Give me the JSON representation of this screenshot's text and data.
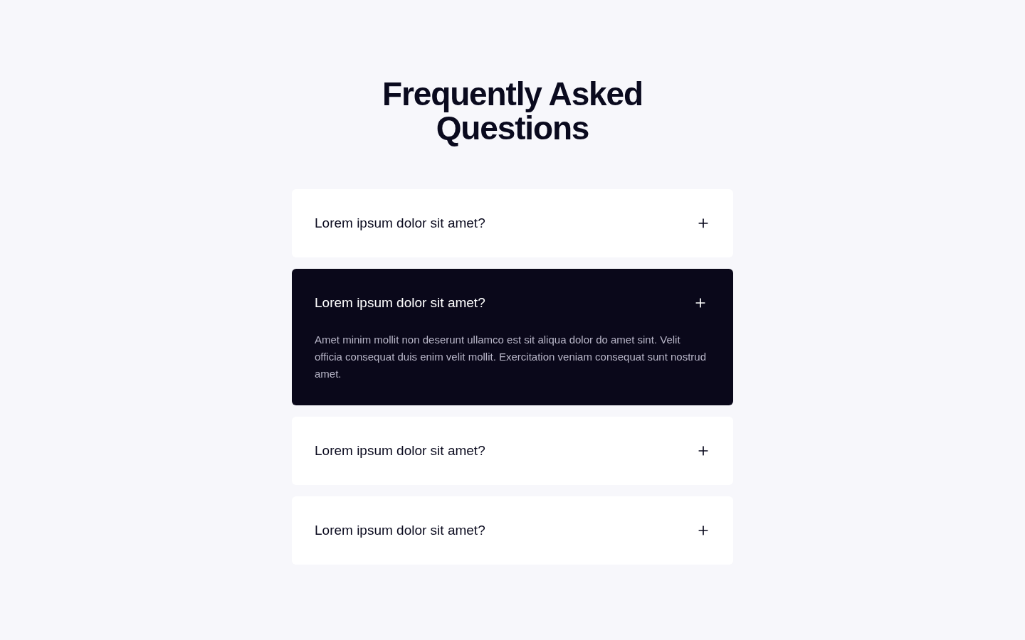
{
  "title": "Frequently Asked Questions",
  "faqs": [
    {
      "question": "Lorem ipsum dolor sit amet?",
      "expanded": false
    },
    {
      "question": "Lorem ipsum dolor sit amet?",
      "expanded": true,
      "answer": "Amet minim mollit non deserunt ullamco est sit aliqua dolor do amet sint. Velit officia consequat duis enim velit mollit. Exercitation veniam consequat sunt nostrud amet."
    },
    {
      "question": "Lorem ipsum dolor sit amet?",
      "expanded": false
    },
    {
      "question": "Lorem ipsum dolor sit amet?",
      "expanded": false
    }
  ]
}
